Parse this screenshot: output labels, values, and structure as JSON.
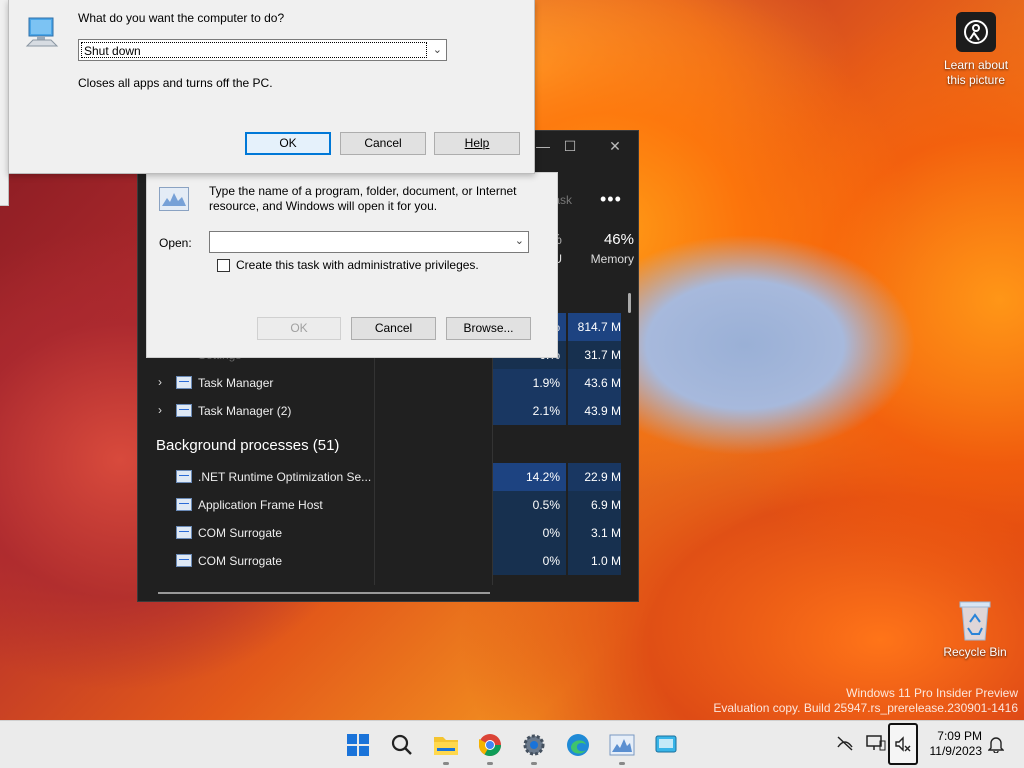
{
  "desktop": {
    "spotlight": {
      "line1": "Learn about",
      "line2": "this picture",
      "icon": "spotlight-camera-icon"
    },
    "recycle_bin": {
      "label": "Recycle Bin",
      "icon": "recycle-bin-icon"
    },
    "watermark": {
      "line1": "Windows 11 Pro Insider Preview",
      "line2": "Evaluation copy. Build 25947.rs_prerelease.230901-1416"
    }
  },
  "task_manager": {
    "controls": {
      "close": "✕",
      "maximize": "☐",
      "minimize": "—"
    },
    "new_task_partial": "task",
    "more_label": "•••",
    "columns": {
      "cpu_partial": "%",
      "cpu_name_partial": "U",
      "mem_pct": "46%",
      "mem_name": "Memory"
    },
    "apps_rows": [
      {
        "name": "",
        "cpu": "%",
        "mem": "814.7 M"
      },
      {
        "name": "Settings",
        "cpu": "0.%",
        "mem": "31.7 M"
      },
      {
        "name": "Task Manager",
        "cpu": "1.9%",
        "mem": "43.6 M"
      },
      {
        "name": "Task Manager (2)",
        "cpu": "2.1%",
        "mem": "43.9 M"
      }
    ],
    "background_header": "Background processes (51)",
    "background_rows": [
      {
        "name": ".NET Runtime Optimization Se...",
        "cpu": "14.2%",
        "mem": "22.9 M"
      },
      {
        "name": "Application Frame Host",
        "cpu": "0.5%",
        "mem": "6.9 M"
      },
      {
        "name": "COM Surrogate",
        "cpu": "0%",
        "mem": "3.1 M"
      },
      {
        "name": "COM Surrogate",
        "cpu": "0%",
        "mem": "1.0 M"
      }
    ]
  },
  "run_dialog": {
    "message": "Type the name of a program, folder, document, or Internet resource, and Windows will open it for you.",
    "open_label": "Open:",
    "open_value": "",
    "admin_checkbox": "Create this task with administrative privileges.",
    "ok": "OK",
    "cancel": "Cancel",
    "browse": "Browse..."
  },
  "shutdown_dialog": {
    "question": "What do you want the computer to do?",
    "selected": "Shut down",
    "description": "Closes all apps and turns off the PC.",
    "ok": "OK",
    "cancel": "Cancel",
    "help": "Help"
  },
  "taskbar": {
    "apps": [
      {
        "name": "start-button",
        "icon": "windows-logo-icon"
      },
      {
        "name": "search-button",
        "icon": "search-icon"
      },
      {
        "name": "file-explorer-button",
        "icon": "folder-icon"
      },
      {
        "name": "chrome-button",
        "icon": "chrome-icon"
      },
      {
        "name": "settings-button",
        "icon": "gear-icon"
      },
      {
        "name": "edge-button",
        "icon": "edge-icon"
      },
      {
        "name": "task-manager-button",
        "icon": "task-manager-icon"
      },
      {
        "name": "generic-app-button",
        "icon": "app-icon"
      }
    ],
    "clock": {
      "time": "7:09 PM",
      "date": "11/9/2023"
    },
    "tray": [
      "network-off-icon",
      "display-icon",
      "volume-muted-icon",
      "notification-bell-icon"
    ]
  },
  "colors": {
    "accent": "#0078d7",
    "tm_bg": "#202020",
    "tm_heat": "#193762",
    "taskbar": "#ebebeb"
  }
}
